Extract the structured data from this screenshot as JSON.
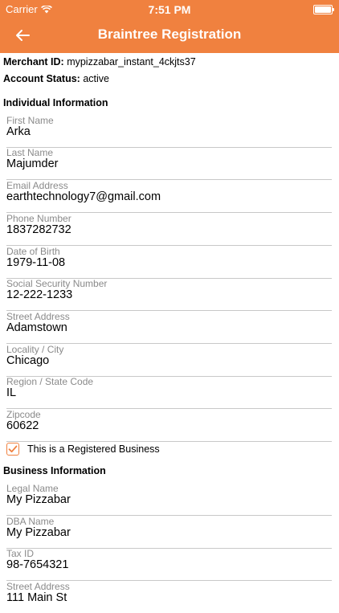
{
  "status_bar": {
    "carrier": "Carrier",
    "time": "7:51 PM"
  },
  "nav": {
    "title": "Braintree Registration",
    "back_icon": "arrow-left-icon"
  },
  "merchant": {
    "id_label": "Merchant ID:",
    "id_value": "mypizzabar_instant_4ckjts37",
    "status_label": "Account Status:",
    "status_value": "active"
  },
  "individual": {
    "title": "Individual Information",
    "fields": [
      {
        "label": "First Name",
        "value": "Arka"
      },
      {
        "label": "Last Name",
        "value": "Majumder"
      },
      {
        "label": "Email Address",
        "value": "earthtechnology7@gmail.com"
      },
      {
        "label": "Phone Number",
        "value": "1837282732"
      },
      {
        "label": "Date of Birth",
        "value": "1979-11-08"
      },
      {
        "label": "Social Security Number",
        "value": "12-222-1233"
      },
      {
        "label": "Street Address",
        "value": "Adamstown"
      },
      {
        "label": "Locality / City",
        "value": "Chicago"
      },
      {
        "label": "Region / State Code",
        "value": "IL"
      },
      {
        "label": "Zipcode",
        "value": "60622"
      }
    ]
  },
  "registered_business": {
    "label": "This is a Registered Business",
    "checked": true
  },
  "business": {
    "title": "Business Information",
    "fields": [
      {
        "label": "Legal Name",
        "value": "My Pizzabar"
      },
      {
        "label": "DBA Name",
        "value": "My Pizzabar"
      },
      {
        "label": "Tax ID",
        "value": "98-7654321"
      },
      {
        "label": "Street Address",
        "value": "111 Main St"
      }
    ]
  },
  "colors": {
    "accent": "#f0813f",
    "label_gray": "#8a8a8a",
    "divider": "#c8c8c8"
  }
}
